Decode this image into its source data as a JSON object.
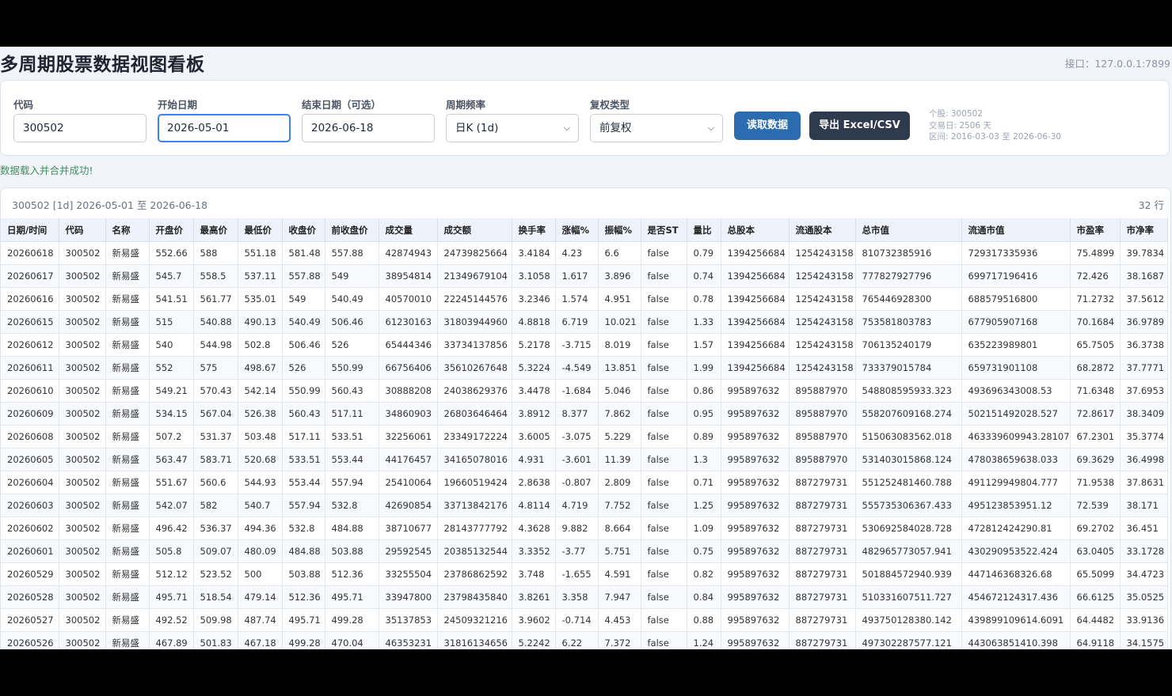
{
  "header": {
    "title": "多周期股票数据视图看板",
    "api": "接口：127.0.0.1:7899"
  },
  "form": {
    "code_label": "代码",
    "code_value": "300502",
    "start_label": "开始日期",
    "start_value": "2026-05-01",
    "end_label": "结束日期（可选）",
    "end_value": "2026-06-18",
    "freq_label": "周期频率",
    "freq_value": "日K (1d)",
    "adjust_label": "复权类型",
    "adjust_value": "前复权",
    "load_button": "读取数据",
    "export_button": "导出 Excel/CSV"
  },
  "stats": {
    "line1": "个股: 300502",
    "line2": "交易日: 2506 天",
    "line3": "区间: 2016-03-03 至 2026-06-30"
  },
  "status": "数据载入并合并成功!",
  "table": {
    "caption": "300502 [1d] 2026-05-01 至 2026-06-18",
    "count": "32 行",
    "columns": [
      "日期/时间",
      "代码",
      "名称",
      "开盘价",
      "最高价",
      "最低价",
      "收盘价",
      "前收盘价",
      "成交量",
      "成交额",
      "换手率",
      "涨幅%",
      "振幅%",
      "是否ST",
      "量比",
      "总股本",
      "流通股本",
      "总市值",
      "流通市值",
      "市盈率",
      "市净率"
    ],
    "rows": [
      [
        "20260618",
        "300502",
        "新易盛",
        "552.66",
        "588",
        "551.18",
        "581.48",
        "557.88",
        "42874943",
        "24739825664",
        "3.4184",
        "4.23",
        "6.6",
        "false",
        "0.79",
        "1394256684",
        "1254243158",
        "810732385916",
        "729317335936",
        "75.4899",
        "39.7834"
      ],
      [
        "20260617",
        "300502",
        "新易盛",
        "545.7",
        "558.5",
        "537.11",
        "557.88",
        "549",
        "38954814",
        "21349679104",
        "3.1058",
        "1.617",
        "3.896",
        "false",
        "0.74",
        "1394256684",
        "1254243158",
        "777827927796",
        "699717196416",
        "72.426",
        "38.1687"
      ],
      [
        "20260616",
        "300502",
        "新易盛",
        "541.51",
        "561.77",
        "535.01",
        "549",
        "540.49",
        "40570010",
        "22245144576",
        "3.2346",
        "1.574",
        "4.951",
        "false",
        "0.78",
        "1394256684",
        "1254243158",
        "765446928300",
        "688579516800",
        "71.2732",
        "37.5612"
      ],
      [
        "20260615",
        "300502",
        "新易盛",
        "515",
        "540.88",
        "490.13",
        "540.49",
        "506.46",
        "61230163",
        "31803944960",
        "4.8818",
        "6.719",
        "10.021",
        "false",
        "1.33",
        "1394256684",
        "1254243158",
        "753581803783",
        "677905907168",
        "70.1684",
        "36.9789"
      ],
      [
        "20260612",
        "300502",
        "新易盛",
        "540",
        "544.98",
        "502.8",
        "506.46",
        "526",
        "65444346",
        "33734137856",
        "5.2178",
        "-3.715",
        "8.019",
        "false",
        "1.57",
        "1394256684",
        "1254243158",
        "706135240179",
        "635223989801",
        "65.7505",
        "36.3738"
      ],
      [
        "20260611",
        "300502",
        "新易盛",
        "552",
        "575",
        "498.67",
        "526",
        "550.99",
        "66756406",
        "35610267648",
        "5.3224",
        "-4.549",
        "13.851",
        "false",
        "1.99",
        "1394256684",
        "1254243158",
        "733379015784",
        "659731901108",
        "68.2872",
        "37.7771"
      ],
      [
        "20260610",
        "300502",
        "新易盛",
        "549.21",
        "570.43",
        "542.14",
        "550.99",
        "560.43",
        "30888208",
        "24038629376",
        "3.4478",
        "-1.684",
        "5.046",
        "false",
        "0.86",
        "995897632",
        "895887970",
        "548808595933.323",
        "493696343008.53",
        "71.6348",
        "37.6953"
      ],
      [
        "20260609",
        "300502",
        "新易盛",
        "534.15",
        "567.04",
        "526.38",
        "560.43",
        "517.11",
        "34860903",
        "26803646464",
        "3.8912",
        "8.377",
        "7.862",
        "false",
        "0.95",
        "995897632",
        "895887970",
        "558207609168.274",
        "502151492028.527",
        "72.8617",
        "38.3409"
      ],
      [
        "20260608",
        "300502",
        "新易盛",
        "507.2",
        "531.37",
        "503.48",
        "517.11",
        "533.51",
        "32256061",
        "23349172224",
        "3.6005",
        "-3.075",
        "5.229",
        "false",
        "0.89",
        "995897632",
        "895887970",
        "515063083562.018",
        "463339609943.28107",
        "67.2301",
        "35.3774"
      ],
      [
        "20260605",
        "300502",
        "新易盛",
        "563.47",
        "583.71",
        "520.68",
        "533.51",
        "553.44",
        "44176457",
        "34165078016",
        "4.931",
        "-3.601",
        "11.39",
        "false",
        "1.3",
        "995897632",
        "895887970",
        "531403015868.124",
        "478038659638.033",
        "69.3629",
        "36.4998"
      ],
      [
        "20260604",
        "300502",
        "新易盛",
        "551.67",
        "560.6",
        "544.93",
        "553.44",
        "557.94",
        "25410064",
        "19660519424",
        "2.8638",
        "-0.807",
        "2.809",
        "false",
        "0.71",
        "995897632",
        "887279731",
        "551252481460.788",
        "491129949804.777",
        "71.9538",
        "37.8631"
      ],
      [
        "20260603",
        "300502",
        "新易盛",
        "542.07",
        "582",
        "540.7",
        "557.94",
        "532.8",
        "42690854",
        "33713842176",
        "4.8114",
        "4.719",
        "7.752",
        "false",
        "1.25",
        "995897632",
        "887279731",
        "555735306367.433",
        "495123853951.12",
        "72.539",
        "38.171"
      ],
      [
        "20260602",
        "300502",
        "新易盛",
        "496.42",
        "536.37",
        "494.36",
        "532.8",
        "484.88",
        "38710677",
        "28143777792",
        "4.3628",
        "9.882",
        "8.664",
        "false",
        "1.09",
        "995897632",
        "887279731",
        "530692584028.728",
        "472812424290.81",
        "69.2702",
        "36.451"
      ],
      [
        "20260601",
        "300502",
        "新易盛",
        "505.8",
        "509.07",
        "480.09",
        "484.88",
        "503.88",
        "29592545",
        "20385132544",
        "3.3352",
        "-3.77",
        "5.751",
        "false",
        "0.75",
        "995897632",
        "887279731",
        "482965773057.941",
        "430290953522.424",
        "63.0405",
        "33.1728"
      ],
      [
        "20260529",
        "300502",
        "新易盛",
        "512.12",
        "523.52",
        "500",
        "503.88",
        "512.36",
        "33255504",
        "23786862592",
        "3.748",
        "-1.655",
        "4.591",
        "false",
        "0.82",
        "995897632",
        "887279731",
        "501884572940.939",
        "447146368326.68",
        "65.5099",
        "34.4723"
      ],
      [
        "20260528",
        "300502",
        "新易盛",
        "495.71",
        "518.54",
        "479.14",
        "512.36",
        "495.71",
        "33947800",
        "23798435840",
        "3.8261",
        "3.358",
        "7.947",
        "false",
        "0.84",
        "995897632",
        "887279731",
        "510331607511.727",
        "454672124317.436",
        "66.6125",
        "35.0525"
      ],
      [
        "20260527",
        "300502",
        "新易盛",
        "492.52",
        "509.98",
        "487.74",
        "495.71",
        "499.28",
        "35137853",
        "24509321216",
        "3.9602",
        "-0.714",
        "4.453",
        "false",
        "0.88",
        "995897632",
        "887279731",
        "493750128380.142",
        "439899109614.6091",
        "64.4482",
        "33.9136"
      ],
      [
        "20260526",
        "300502",
        "新易盛",
        "467.89",
        "501.83",
        "467.18",
        "499.28",
        "470.04",
        "46353231",
        "31816134656",
        "5.2242",
        "6.22",
        "7.372",
        "false",
        "1.24",
        "995897632",
        "887279731",
        "497302287577.121",
        "443063851410.398",
        "64.9118",
        "34.1575"
      ]
    ]
  }
}
